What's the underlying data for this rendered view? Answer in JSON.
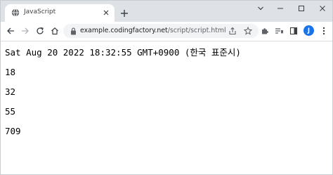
{
  "browser": {
    "tab_title": "JavaScript",
    "url_host": "example.codingfactory.net",
    "url_path": "/script/script.html",
    "profile_initial": "J",
    "accent_color": "#1a73e8"
  },
  "page": {
    "lines": [
      "Sat Aug 20 2022 18:32:55 GMT+0900 (한국 표준시)",
      "18",
      "32",
      "55",
      "709"
    ]
  }
}
